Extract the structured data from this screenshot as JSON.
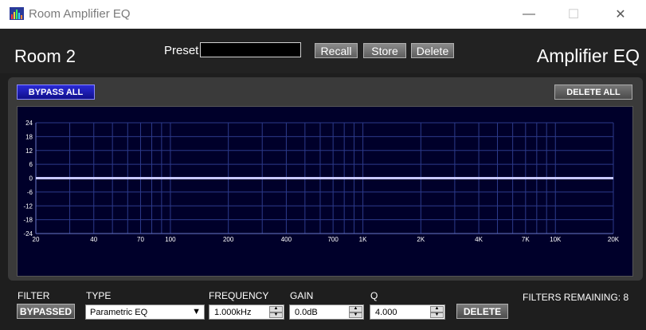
{
  "window": {
    "title": "Room Amplifier EQ",
    "controls": {
      "minimize": "—",
      "maximize": "☐",
      "close": "✕"
    }
  },
  "header": {
    "room_name": "Room 2",
    "app_label": "Amplifier EQ",
    "preset_label": "Preset",
    "preset_value": "",
    "recall_label": "Recall",
    "store_label": "Store",
    "delete_label": "Delete"
  },
  "toolbar": {
    "bypass_all_label": "BYPASS ALL",
    "delete_all_label": "DELETE ALL"
  },
  "chart_data": {
    "type": "line",
    "xscale": "log",
    "xlim": [
      20,
      20000
    ],
    "ylim": [
      -24,
      24
    ],
    "yticks": [
      24,
      18,
      12,
      6,
      0,
      -6,
      -12,
      -18,
      -24
    ],
    "xticks": [
      {
        "v": 20,
        "label": "20"
      },
      {
        "v": 40,
        "label": "40"
      },
      {
        "v": 70,
        "label": "70"
      },
      {
        "v": 100,
        "label": "100"
      },
      {
        "v": 200,
        "label": "200"
      },
      {
        "v": 400,
        "label": "400"
      },
      {
        "v": 700,
        "label": "700"
      },
      {
        "v": 1000,
        "label": "1K"
      },
      {
        "v": 2000,
        "label": "2K"
      },
      {
        "v": 4000,
        "label": "4K"
      },
      {
        "v": 7000,
        "label": "7K"
      },
      {
        "v": 10000,
        "label": "10K"
      },
      {
        "v": 20000,
        "label": "20K"
      }
    ],
    "series": [
      {
        "x": [
          20,
          20000
        ],
        "y": [
          0,
          0
        ]
      }
    ],
    "grid": true,
    "colors": {
      "background": "#00002a",
      "grid": "#2c3a8a",
      "curve": "#c8c8ff",
      "text": "#ffffff"
    }
  },
  "controls": {
    "filter_label": "FILTER",
    "filter_button": "BYPASSED",
    "type_label": "TYPE",
    "type_value": "Parametric EQ",
    "frequency_label": "FREQUENCY",
    "frequency_value": "1.000kHz",
    "gain_label": "GAIN",
    "gain_value": "0.0dB",
    "q_label": "Q",
    "q_value": "4.000",
    "delete_label": "DELETE",
    "filters_remaining": "FILTERS REMAINING: 8"
  }
}
